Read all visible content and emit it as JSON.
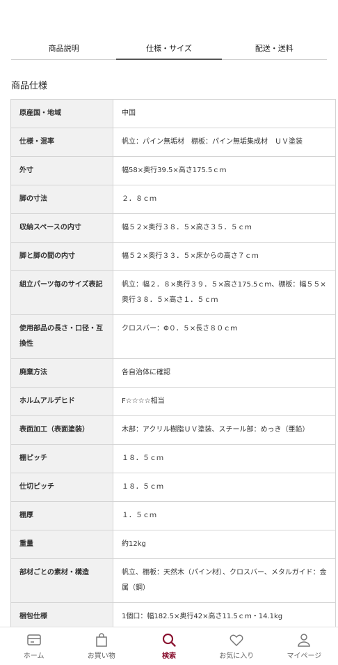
{
  "tabs": [
    {
      "label": "商品説明"
    },
    {
      "label": "仕様・サイズ"
    },
    {
      "label": "配送・送料"
    }
  ],
  "section_title": "商品仕様",
  "specs": [
    {
      "key": "原産国・地域",
      "value": "中国"
    },
    {
      "key": "仕様・混率",
      "value": "帆立：パイン無垢材　棚板：パイン無垢集成材　ＵＶ塗装"
    },
    {
      "key": "外寸",
      "value": "幅58×奥行39.5×高さ175.5ｃｍ"
    },
    {
      "key": "脚の寸法",
      "value": "２．８ｃｍ"
    },
    {
      "key": "収納スペースの内寸",
      "value": "幅５２×奥行３８．５×高さ３５．５ｃｍ"
    },
    {
      "key": "脚と脚の間の内寸",
      "value": "幅５２×奥行３３．５×床からの高さ７ｃｍ"
    },
    {
      "key": "組立パーツ毎のサイズ表記",
      "value": "帆立：幅２．８×奥行３９．５×高さ175.5ｃｍ、棚板：幅５５×奥行３８．５×高さ１．５ｃｍ"
    },
    {
      "key": "使用部品の長さ・口径・互換性",
      "value": "クロスバー：Φ０．５×長さ８０ｃｍ"
    },
    {
      "key": "廃棄方法",
      "value": "各自治体に確認"
    },
    {
      "key": "ホルムアルデヒド",
      "value": "F☆☆☆☆相当"
    },
    {
      "key": "表面加工（表面塗装）",
      "value": "木部：アクリル樹脂ＵＶ塗装、スチール部：めっき（亜鉛）"
    },
    {
      "key": "棚ピッチ",
      "value": "１８．５ｃｍ"
    },
    {
      "key": "仕切ピッチ",
      "value": "１８．５ｃｍ"
    },
    {
      "key": "棚厚",
      "value": "１．５ｃｍ"
    },
    {
      "key": "重量",
      "value": "約12kg"
    },
    {
      "key": "部材ごとの素材・構造",
      "value": "帆立、棚板：天然木（パイン材）、クロスバー、メタルガイド：金属（鋼）"
    },
    {
      "key": "梱包仕様",
      "value": "1個口：幅182.5×奥行42×高さ11.5ｃｍ・14.1kg"
    }
  ],
  "bottom_nav": [
    {
      "label": "ホーム",
      "icon": "home-card-icon"
    },
    {
      "label": "お買い物",
      "icon": "shopping-bag-icon"
    },
    {
      "label": "検索",
      "icon": "search-icon"
    },
    {
      "label": "お気に入り",
      "icon": "heart-icon"
    },
    {
      "label": "マイページ",
      "icon": "user-icon"
    }
  ],
  "colors": {
    "accent": "#8a1230",
    "key_bg": "#f1f1f1",
    "border": "#d4d4d4"
  }
}
